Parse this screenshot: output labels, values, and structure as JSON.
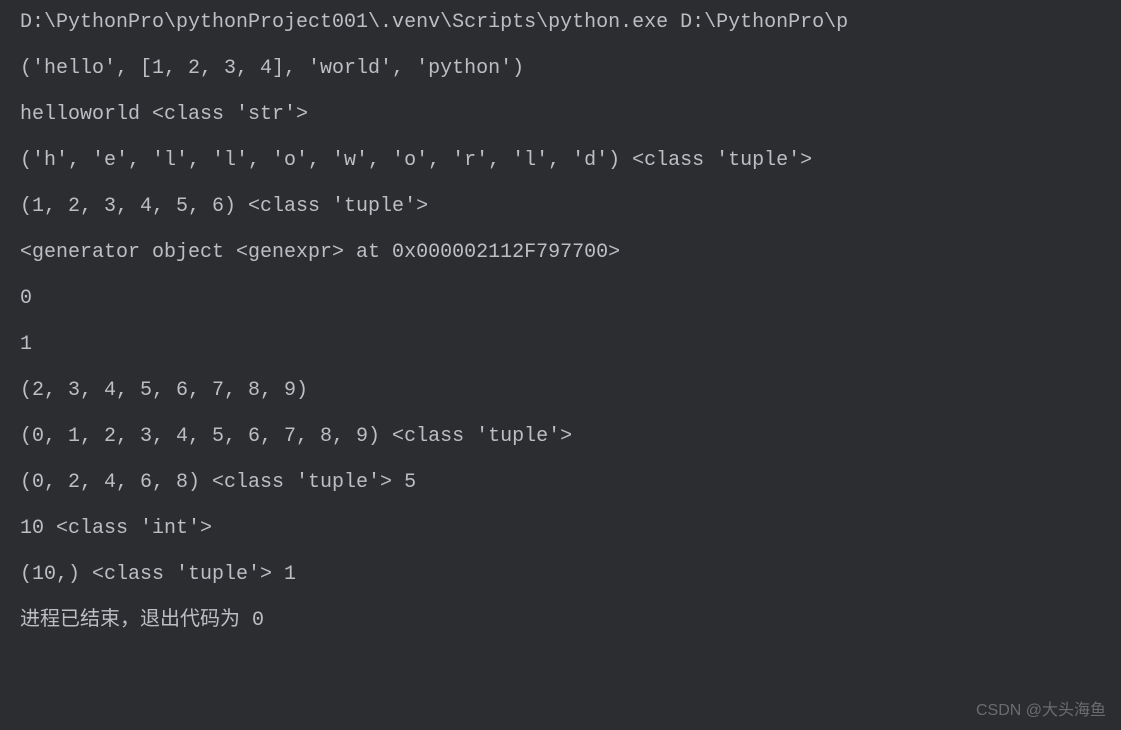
{
  "output": {
    "lines": [
      "D:\\PythonPro\\pythonProject001\\.venv\\Scripts\\python.exe D:\\PythonPro\\p",
      "('hello', [1, 2, 3, 4], 'world', 'python')",
      "helloworld <class 'str'>",
      "('h', 'e', 'l', 'l', 'o', 'w', 'o', 'r', 'l', 'd') <class 'tuple'>",
      "(1, 2, 3, 4, 5, 6) <class 'tuple'>",
      "<generator object <genexpr> at 0x000002112F797700>",
      "0",
      "1",
      "(2, 3, 4, 5, 6, 7, 8, 9)",
      "(0, 1, 2, 3, 4, 5, 6, 7, 8, 9) <class 'tuple'>",
      "(0, 2, 4, 6, 8) <class 'tuple'> 5",
      "10 <class 'int'>",
      "(10,) <class 'tuple'> 1",
      "",
      "进程已结束，退出代码为 0"
    ]
  },
  "watermark": "CSDN @大头海鱼"
}
